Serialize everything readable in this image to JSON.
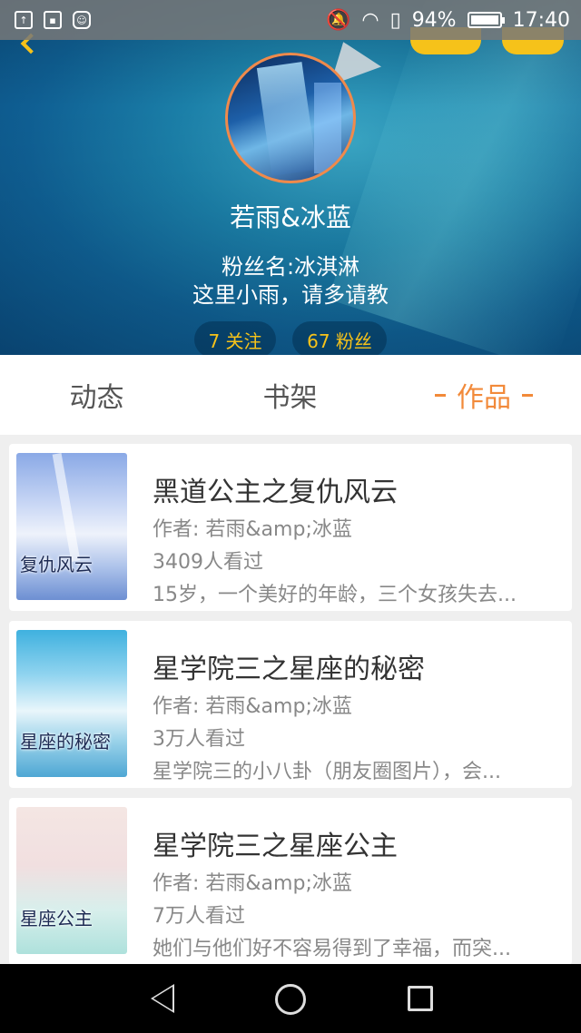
{
  "status_bar": {
    "battery": "94%",
    "time": "17:40",
    "left_icons": [
      "notification-icon",
      "image-icon",
      "android-icon"
    ],
    "right_icons": [
      "mute-icon",
      "wifi-icon",
      "sim-icon",
      "battery-icon"
    ]
  },
  "profile": {
    "name": "若雨&冰蓝",
    "fan_name": "粉丝名:冰淇淋",
    "bio": "这里小雨，请多请教",
    "following": "7 关注",
    "followers": "67 粉丝"
  },
  "tabs": [
    {
      "label": "动态",
      "active": false
    },
    {
      "label": "书架",
      "active": false
    },
    {
      "label": "作品",
      "active": true
    }
  ],
  "works": [
    {
      "title": "黑道公主之复仇风云",
      "author": "作者: 若雨&amp;冰蓝",
      "views": "3409人看过",
      "desc": "15岁，一个美好的年龄，三个女孩失去...",
      "cover_text": "复仇风云"
    },
    {
      "title": "星学院三之星座的秘密",
      "author": "作者: 若雨&amp;冰蓝",
      "views": "3万人看过",
      "desc": "星学院三的小八卦（朋友圈图片），会...",
      "cover_text": "星座的秘密"
    },
    {
      "title": "星学院三之星座公主",
      "author": "作者: 若雨&amp;冰蓝",
      "views": "7万人看过",
      "desc": "她们与他们好不容易得到了幸福，而突...",
      "cover_text": "星座公主"
    }
  ],
  "colors": {
    "accent": "#f28a3a",
    "stat_text": "#f6c21a"
  }
}
